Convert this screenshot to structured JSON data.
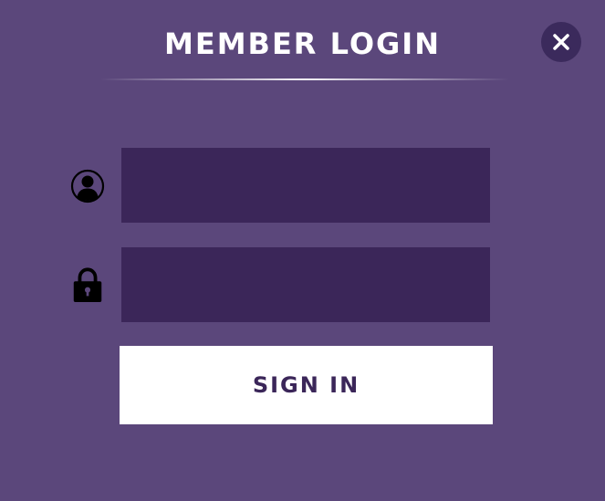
{
  "modal": {
    "title": "MEMBER LOGIN",
    "close_icon": "close-icon",
    "username": {
      "icon": "user-icon",
      "value": "",
      "placeholder": ""
    },
    "password": {
      "icon": "lock-icon",
      "value": "",
      "placeholder": ""
    },
    "signin_label": "SIGN IN"
  },
  "colors": {
    "background": "#5b477b",
    "input_background": "#3b2659",
    "button_background": "#ffffff",
    "button_text": "#3b2659",
    "close_button": "#3b2a5c"
  }
}
